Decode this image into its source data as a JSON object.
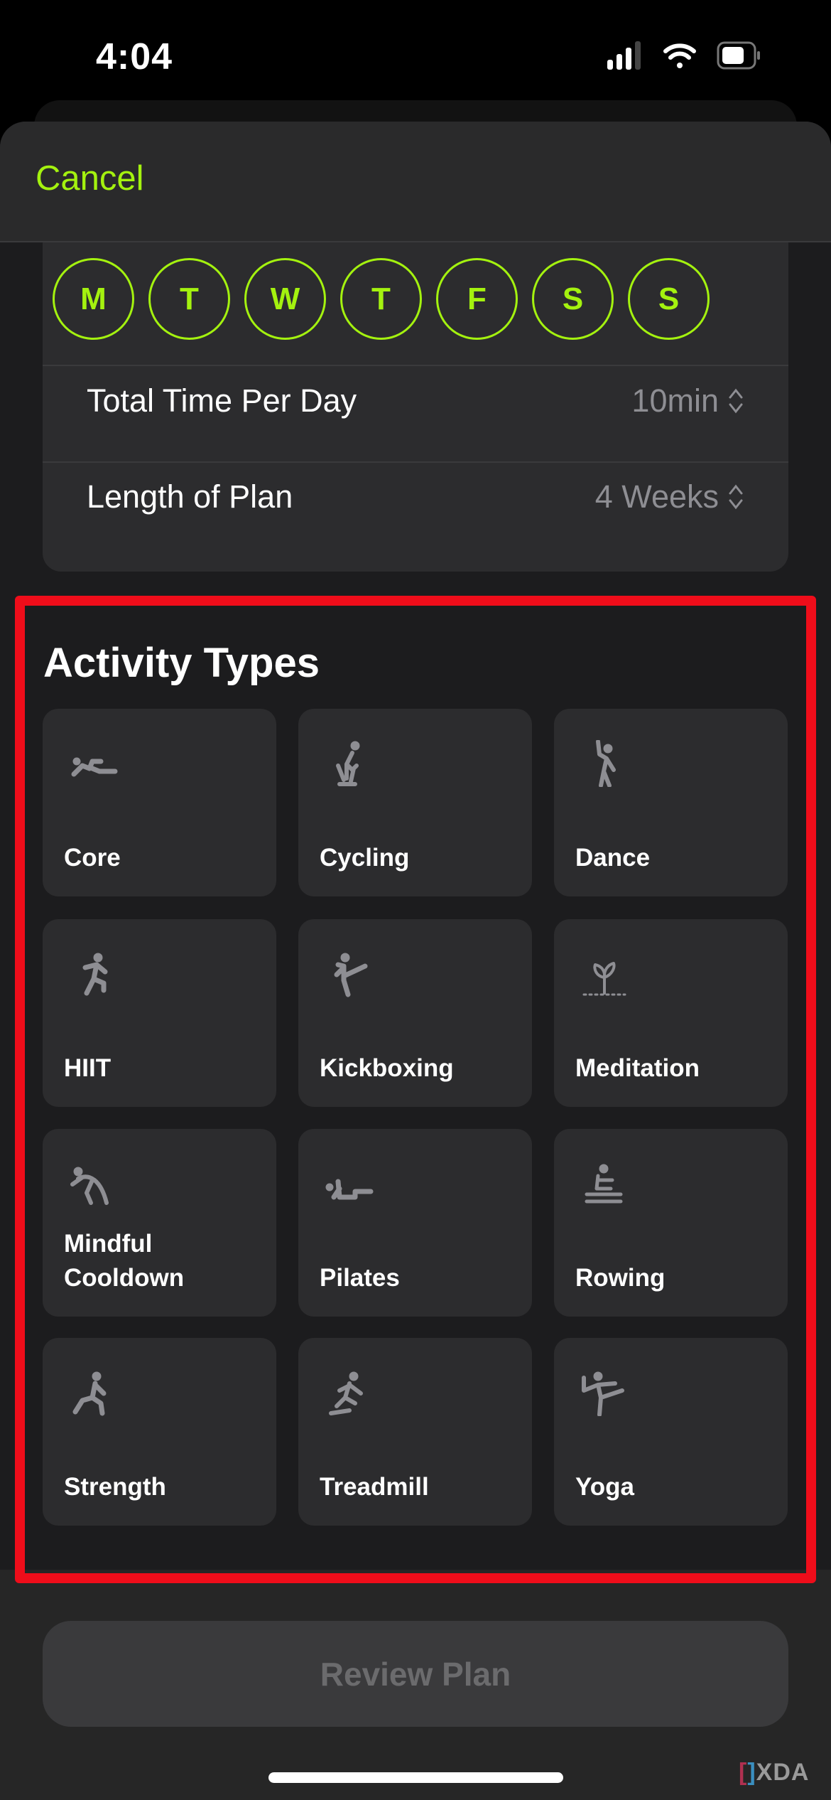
{
  "status_bar": {
    "time": "4:04",
    "icons": [
      "cellular-signal-icon",
      "wifi-icon",
      "battery-icon"
    ]
  },
  "header": {
    "cancel_label": "Cancel"
  },
  "schedule": {
    "days": [
      "M",
      "T",
      "W",
      "T",
      "F",
      "S",
      "S"
    ],
    "rows": [
      {
        "label": "Total Time Per Day",
        "value": "10min"
      },
      {
        "label": "Length of Plan",
        "value": "4 Weeks"
      }
    ]
  },
  "activity_section": {
    "title": "Activity Types",
    "items": [
      {
        "label": "Core",
        "icon": "core-icon"
      },
      {
        "label": "Cycling",
        "icon": "cycling-icon"
      },
      {
        "label": "Dance",
        "icon": "dance-icon"
      },
      {
        "label": "HIIT",
        "icon": "hiit-icon"
      },
      {
        "label": "Kickboxing",
        "icon": "kickboxing-icon"
      },
      {
        "label": "Meditation",
        "icon": "meditation-icon"
      },
      {
        "label": "Mindful\nCooldown",
        "icon": "mindful-cooldown-icon"
      },
      {
        "label": "Pilates",
        "icon": "pilates-icon"
      },
      {
        "label": "Rowing",
        "icon": "rowing-icon"
      },
      {
        "label": "Strength",
        "icon": "strength-icon"
      },
      {
        "label": "Treadmill",
        "icon": "treadmill-icon"
      },
      {
        "label": "Yoga",
        "icon": "yoga-icon"
      }
    ]
  },
  "footer": {
    "review_label": "Review Plan"
  },
  "watermark": "XDA",
  "colors": {
    "accent": "#a4f20f",
    "highlight_box": "#ef0d1a",
    "tile_bg": "#2c2c2e",
    "icon": "#8e8e93"
  }
}
